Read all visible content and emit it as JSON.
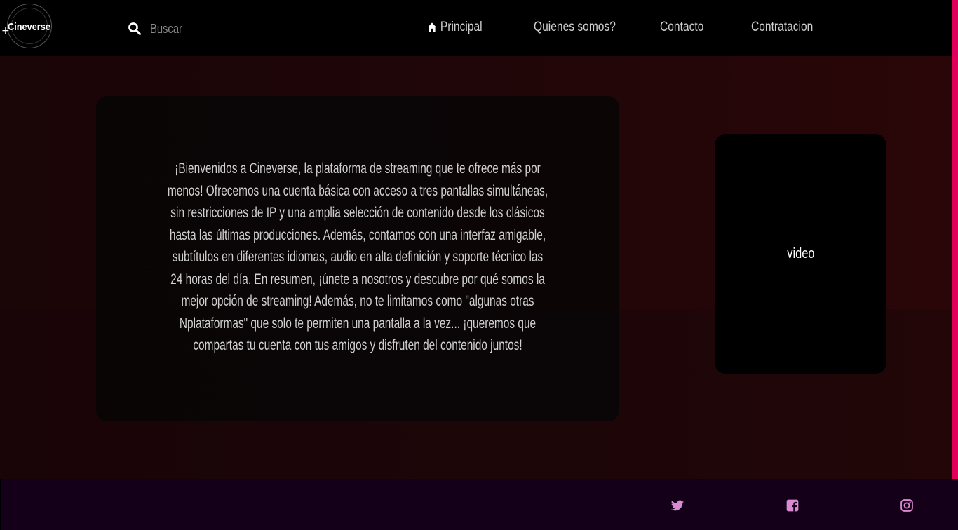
{
  "brand": {
    "name": "Cineverse",
    "plus": "+"
  },
  "search": {
    "placeholder": "Buscar"
  },
  "nav": {
    "home": "Principal",
    "about": "Quienes somos?",
    "contact": "Contacto",
    "hire": "Contratacion"
  },
  "intro": {
    "text": "¡Bienvenidos a Cineverse, la plataforma de streaming que te ofrece más por menos! Ofrecemos una cuenta básica con acceso a tres pantallas simultáneas, sin restricciones de IP y una amplia selección de contenido desde los clásicos hasta las últimas producciones. Además, contamos con una interfaz amigable, subtítulos en diferentes idiomas, audio en alta definición y soporte técnico las 24 horas del día. En resumen, ¡únete a nosotros y descubre por qué somos la mejor opción de streaming! Además, no te limitamos como \"algunas otras Nplataformas\" que solo te permiten una pantalla a la vez... ¡queremos que compartas tu cuenta con tus amigos y disfruten del contenido juntos!"
  },
  "video": {
    "label": "video"
  },
  "footer": {
    "icons": [
      "twitter-icon",
      "facebook-icon",
      "instagram-icon"
    ]
  },
  "colors": {
    "accent": "#e0005a",
    "footer_bg": "#15001a",
    "social_icon": "#d98ad0",
    "navbar_bg": "#000000"
  }
}
